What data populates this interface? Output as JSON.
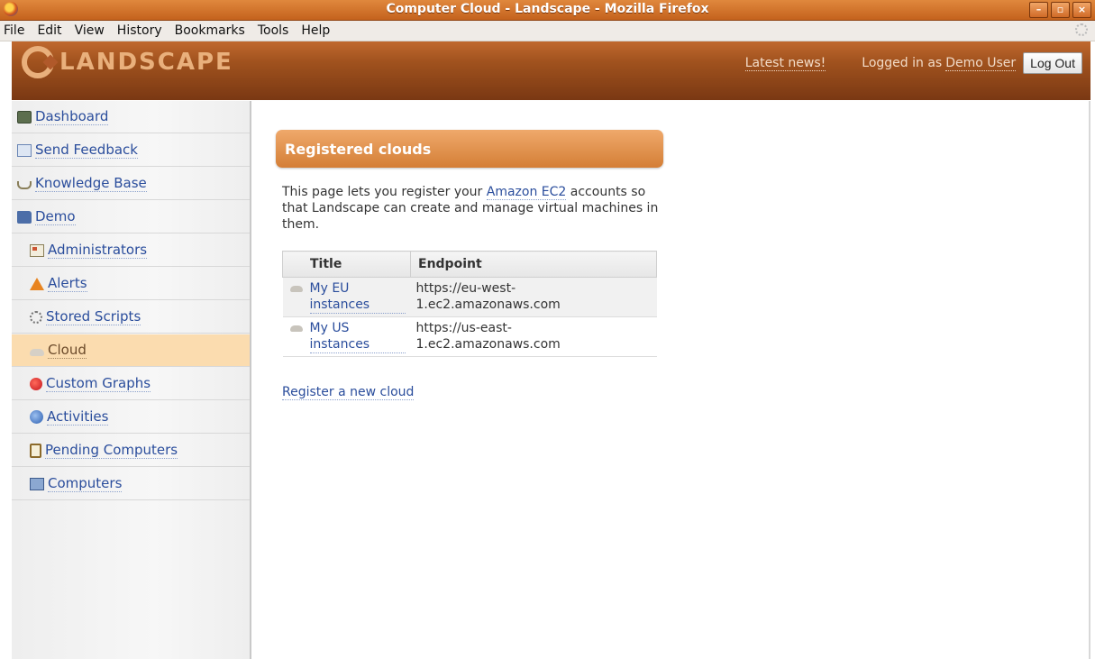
{
  "window": {
    "title": "Computer Cloud - Landscape - Mozilla Firefox",
    "buttons": [
      "–",
      "▫",
      "×"
    ]
  },
  "menubar": {
    "items": [
      "File",
      "Edit",
      "View",
      "History",
      "Bookmarks",
      "Tools",
      "Help"
    ]
  },
  "header": {
    "logo_text": "LANDSCAPE",
    "latest_news": "Latest news!",
    "logged_in_prefix": "Logged in as",
    "user_name": "Demo User",
    "logout_label": "Log Out",
    "colors": {
      "brand_dark": "#7a3813",
      "brand_accent": "#e9b07c"
    }
  },
  "sidebar": {
    "items": [
      {
        "label": "Dashboard",
        "icon": "dashboard-icon"
      },
      {
        "label": "Send Feedback",
        "icon": "feedback-icon"
      },
      {
        "label": "Knowledge Base",
        "icon": "knowledge-base-icon"
      },
      {
        "label": "Demo",
        "icon": "folder-icon"
      },
      {
        "label": "Administrators",
        "icon": "administrators-icon"
      },
      {
        "label": "Alerts",
        "icon": "alert-icon"
      },
      {
        "label": "Stored Scripts",
        "icon": "scripts-icon"
      },
      {
        "label": "Cloud",
        "icon": "cloud-icon",
        "active": true
      },
      {
        "label": "Custom Graphs",
        "icon": "graph-icon"
      },
      {
        "label": "Activities",
        "icon": "activities-icon"
      },
      {
        "label": "Pending Computers",
        "icon": "pending-computers-icon"
      },
      {
        "label": "Computers",
        "icon": "computers-icon"
      }
    ]
  },
  "main": {
    "section_title": "Registered clouds",
    "intro_before": "This page lets you register your",
    "intro_link": "Amazon EC2",
    "intro_after": "accounts so that Landscape can create and manage virtual machines in them.",
    "table": {
      "headers": [
        "Title",
        "Endpoint"
      ],
      "rows": [
        {
          "title": "My EU instances",
          "endpoint": "https://eu-west-1.ec2.amazonaws.com"
        },
        {
          "title": "My US instances",
          "endpoint": "https://us-east-1.ec2.amazonaws.com"
        }
      ]
    },
    "register_link": "Register a new cloud"
  }
}
